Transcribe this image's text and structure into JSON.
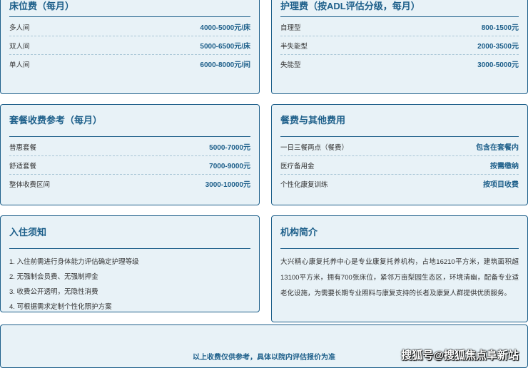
{
  "cards": {
    "bed": {
      "title": "床位费（每月）",
      "rows": [
        {
          "label": "多人间",
          "value": "4000-5000元/床"
        },
        {
          "label": "双人间",
          "value": "5000-6500元/床"
        },
        {
          "label": "单人间",
          "value": "6000-8000元/间"
        }
      ]
    },
    "care": {
      "title": "护理费（按ADL评估分级，每月）",
      "rows": [
        {
          "label": "自理型",
          "value": "800-1500元"
        },
        {
          "label": "半失能型",
          "value": "2000-3500元"
        },
        {
          "label": "失能型",
          "value": "3000-5000元"
        }
      ]
    },
    "package": {
      "title": "套餐收费参考（每月）",
      "rows": [
        {
          "label": "普惠套餐",
          "value": "5000-7000元"
        },
        {
          "label": "舒适套餐",
          "value": "7000-9000元"
        },
        {
          "label": "整体收费区间",
          "value": "3000-10000元"
        }
      ]
    },
    "meal": {
      "title": "餐费与其他费用",
      "rows": [
        {
          "label": "一日三餐两点（餐费）",
          "value": "包含在套餐内"
        },
        {
          "label": "医疗备用金",
          "value": "按需缴纳"
        },
        {
          "label": "个性化康复训练",
          "value": "按项目收费"
        }
      ]
    },
    "notice": {
      "title": "入住须知",
      "items": [
        "1. 入住前需进行身体能力评估确定护理等级",
        "2. 无强制会员费、无强制押金",
        "3. 收费公开透明，无隐性消费",
        "4. 可根据需求定制个性化照护方案"
      ]
    },
    "intro": {
      "title": "机构简介",
      "text": "大兴精心康复托养中心是专业康复托养机构，占地16210平方米，建筑面积超13100平方米，拥有700张床位，紧邻万亩梨园生态区，环境清幽，配备专业适老化设施，为需要长期专业照料与康复支持的长者及康复人群提供优质服务。"
    }
  },
  "footer": {
    "note": "以上收费仅供参考，具体以院内评估报价为准",
    "watermark": "搜狐号@搜狐焦点阜新站"
  }
}
